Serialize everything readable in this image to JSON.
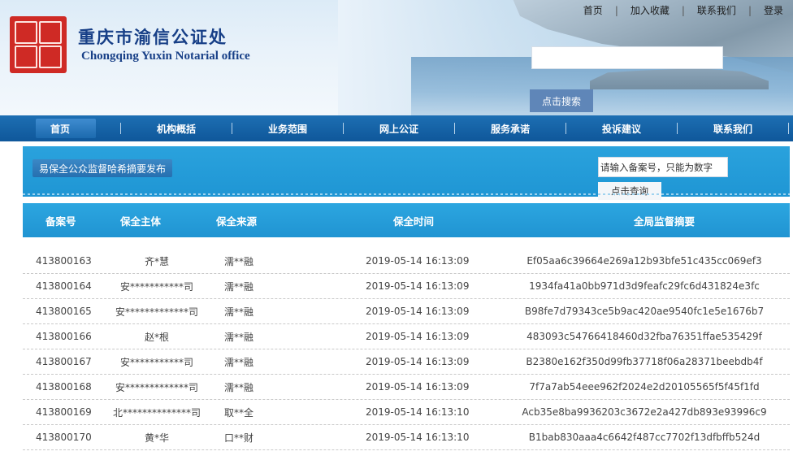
{
  "header": {
    "org_name_cn": "重庆市渝信公证处",
    "org_name_en": "Chongqing Yuxin Notarial office",
    "top_links": [
      "首页",
      "加入收藏",
      "联系我们",
      "登录"
    ],
    "search_value": "",
    "search_button": "点击搜索"
  },
  "nav": {
    "items": [
      "首页",
      "机构概括",
      "业务范围",
      "网上公证",
      "服务承诺",
      "投诉建议",
      "联系我们"
    ],
    "active_index": 0
  },
  "band": {
    "title": "易保全公众监督哈希摘要发布",
    "query_placeholder": "请输入备案号，只能为数字",
    "query_button": "点击查询"
  },
  "table": {
    "columns": [
      "备案号",
      "保全主体",
      "保全来源",
      "保全时间",
      "全局监督摘要"
    ],
    "rows": [
      [
        "413800163",
        "齐*慧",
        "濡**融",
        "2019-05-14 16:13:09",
        "Ef05aa6c39664e269a12b93bfe51c435cc069ef3"
      ],
      [
        "413800164",
        "安***********司",
        "濡**融",
        "2019-05-14 16:13:09",
        "1934fa41a0bb971d3d9feafc29fc6d431824e3fc"
      ],
      [
        "413800165",
        "安*************司",
        "濡**融",
        "2019-05-14 16:13:09",
        "B98fe7d79343ce5b9ac420ae9540fc1e5e1676b7"
      ],
      [
        "413800166",
        "赵*根",
        "濡**融",
        "2019-05-14 16:13:09",
        "483093c54766418460d32fba76351ffae535429f"
      ],
      [
        "413800167",
        "安***********司",
        "濡**融",
        "2019-05-14 16:13:09",
        "B2380e162f350d99fb37718f06a28371beebdb4f"
      ],
      [
        "413800168",
        "安*************司",
        "濡**融",
        "2019-05-14 16:13:09",
        "7f7a7ab54eee962f2024e2d20105565f5f45f1fd"
      ],
      [
        "413800169",
        "北**************司",
        "取**全",
        "2019-05-14 16:13:10",
        "Acb35e8ba9936203c3672e2a427db893e93996c9"
      ],
      [
        "413800170",
        "黄*华",
        "口**财",
        "2019-05-14 16:13:10",
        "B1bab830aaa4c6642f487cc7702f13dfbffb524d"
      ]
    ]
  },
  "colors": {
    "nav_blue": "#0f579a",
    "band_blue": "#1f96d4",
    "seal_red": "#cf2a25",
    "title_navy": "#173f87"
  }
}
